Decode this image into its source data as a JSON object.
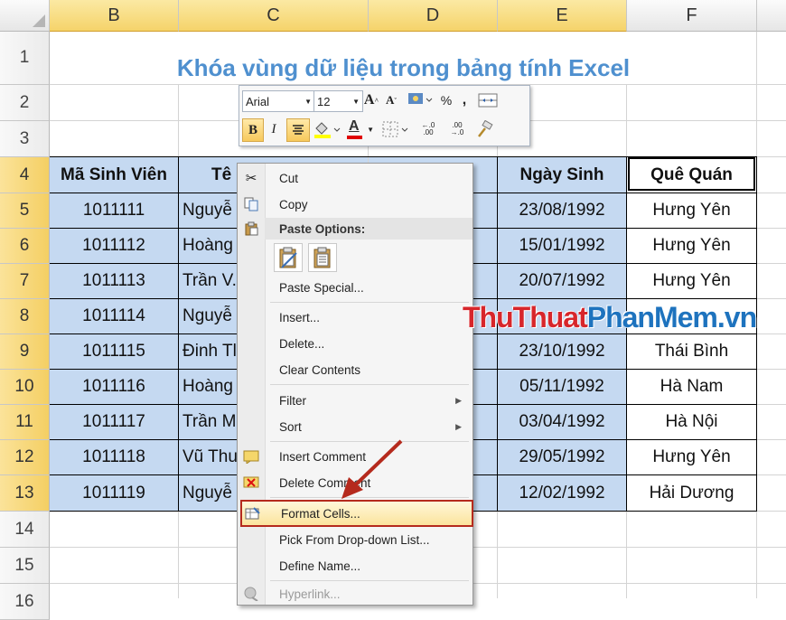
{
  "columns": [
    "B",
    "C",
    "D",
    "E",
    "F"
  ],
  "rows": [
    "1",
    "2",
    "3",
    "4",
    "5",
    "6",
    "7",
    "8",
    "9",
    "10",
    "11",
    "12",
    "13",
    "14",
    "15",
    "16"
  ],
  "title": "Khóa vùng dữ liệu trong bảng tính Excel",
  "headers": {
    "ma_sinh_vien": "Mã Sinh Viên",
    "ten": "Tê",
    "ngay_sinh": "Ngày Sinh",
    "que_quan": "Quê Quán"
  },
  "data_rows": [
    {
      "ma": "1011111",
      "ten": "Nguyễ",
      "ngay": "23/08/1992",
      "que": "Hưng Yên"
    },
    {
      "ma": "1011112",
      "ten": "Hoàng",
      "ngay": "15/01/1992",
      "que": "Hưng Yên"
    },
    {
      "ma": "1011113",
      "ten": "Trần V.",
      "ngay": "20/07/1992",
      "que": "Hưng Yên"
    },
    {
      "ma": "1011114",
      "ten": "Nguyễ",
      "ngay": "",
      "que": ""
    },
    {
      "ma": "1011115",
      "ten": "Đinh Tl",
      "ngay": "23/10/1992",
      "que": "Thái Bình"
    },
    {
      "ma": "1011116",
      "ten": "Hoàng",
      "ngay": "05/11/1992",
      "que": "Hà Nam"
    },
    {
      "ma": "1011117",
      "ten": "Trần M",
      "ngay": "03/04/1992",
      "que": "Hà Nội"
    },
    {
      "ma": "1011118",
      "ten": "Vũ Thu",
      "ngay": "29/05/1992",
      "que": "Hưng Yên"
    },
    {
      "ma": "1011119",
      "ten": "Nguyễ",
      "ngay": "12/02/1992",
      "que": "Hải Dương"
    }
  ],
  "mini_toolbar": {
    "font_name": "Arial",
    "font_size": "12",
    "percent": "%",
    "comma": ",",
    "bold": "B",
    "italic": "I",
    "font_color_letter": "A",
    "inc_decimal": "←.0\n.00",
    "dec_decimal": ".00\n→.0"
  },
  "context_menu": {
    "cut": "Cut",
    "copy": "Copy",
    "paste_options": "Paste Options:",
    "paste_special": "Paste Special...",
    "insert": "Insert...",
    "delete": "Delete...",
    "clear_contents": "Clear Contents",
    "filter": "Filter",
    "sort": "Sort",
    "insert_comment": "Insert Comment",
    "delete_comment": "Delete Comment",
    "format_cells": "Format Cells...",
    "pick_from_list": "Pick From Drop-down List...",
    "define_name": "Define Name...",
    "hyperlink": "Hyperlink..."
  },
  "watermark": {
    "part1": "ThuThuat",
    "part2": "PhanMem",
    "part3": ".vn"
  },
  "colors": {
    "title": "#4f90cf",
    "header_selected": "#f5d36a",
    "cell_selected": "#c5d9f1",
    "highlight_border": "#b52a1d",
    "arrow": "#b52a1d",
    "watermark_red": "#d7262b",
    "watermark_blue": "#1e73be"
  }
}
